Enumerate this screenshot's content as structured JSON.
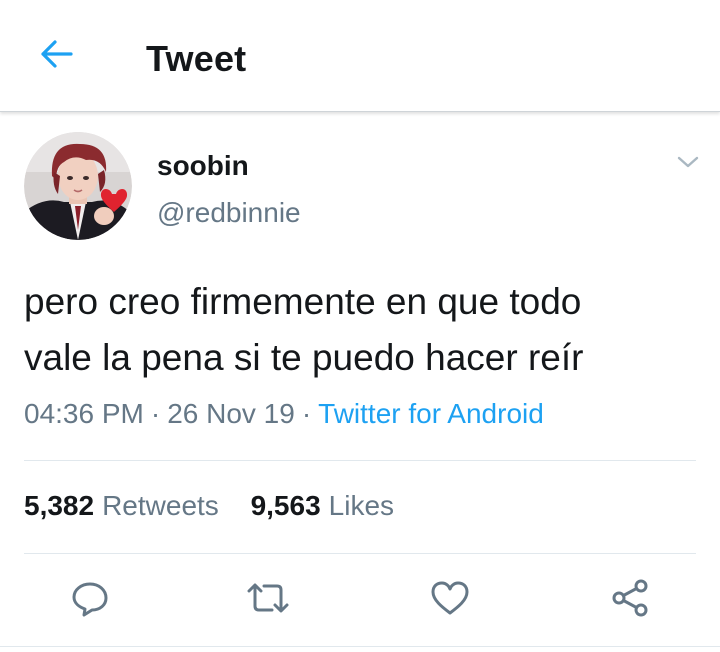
{
  "header": {
    "title": "Tweet",
    "back_icon": "arrow-left-icon"
  },
  "tweet": {
    "author": {
      "display_name": "soobin",
      "handle": "@redbinnie",
      "avatar_icon": "profile-photo-avatar"
    },
    "text_lines": [
      "pero creo firmemente en que todo",
      "vale la pena si te puedo hacer reír"
    ],
    "time": "04:36 PM",
    "date": "26 Nov 19",
    "separator": "·",
    "source": "Twitter for Android",
    "menu_icon": "chevron-down-icon"
  },
  "stats": {
    "retweets_count": "5,382",
    "retweets_label": "Retweets",
    "likes_count": "9,563",
    "likes_label": "Likes"
  },
  "actions": [
    {
      "icon": "reply-icon"
    },
    {
      "icon": "retweet-icon"
    },
    {
      "icon": "heart-icon"
    },
    {
      "icon": "share-icon"
    }
  ],
  "colors": {
    "accent": "#1da1f2",
    "text": "#14171a",
    "secondary": "#657786",
    "divider": "#e1e8ed"
  }
}
